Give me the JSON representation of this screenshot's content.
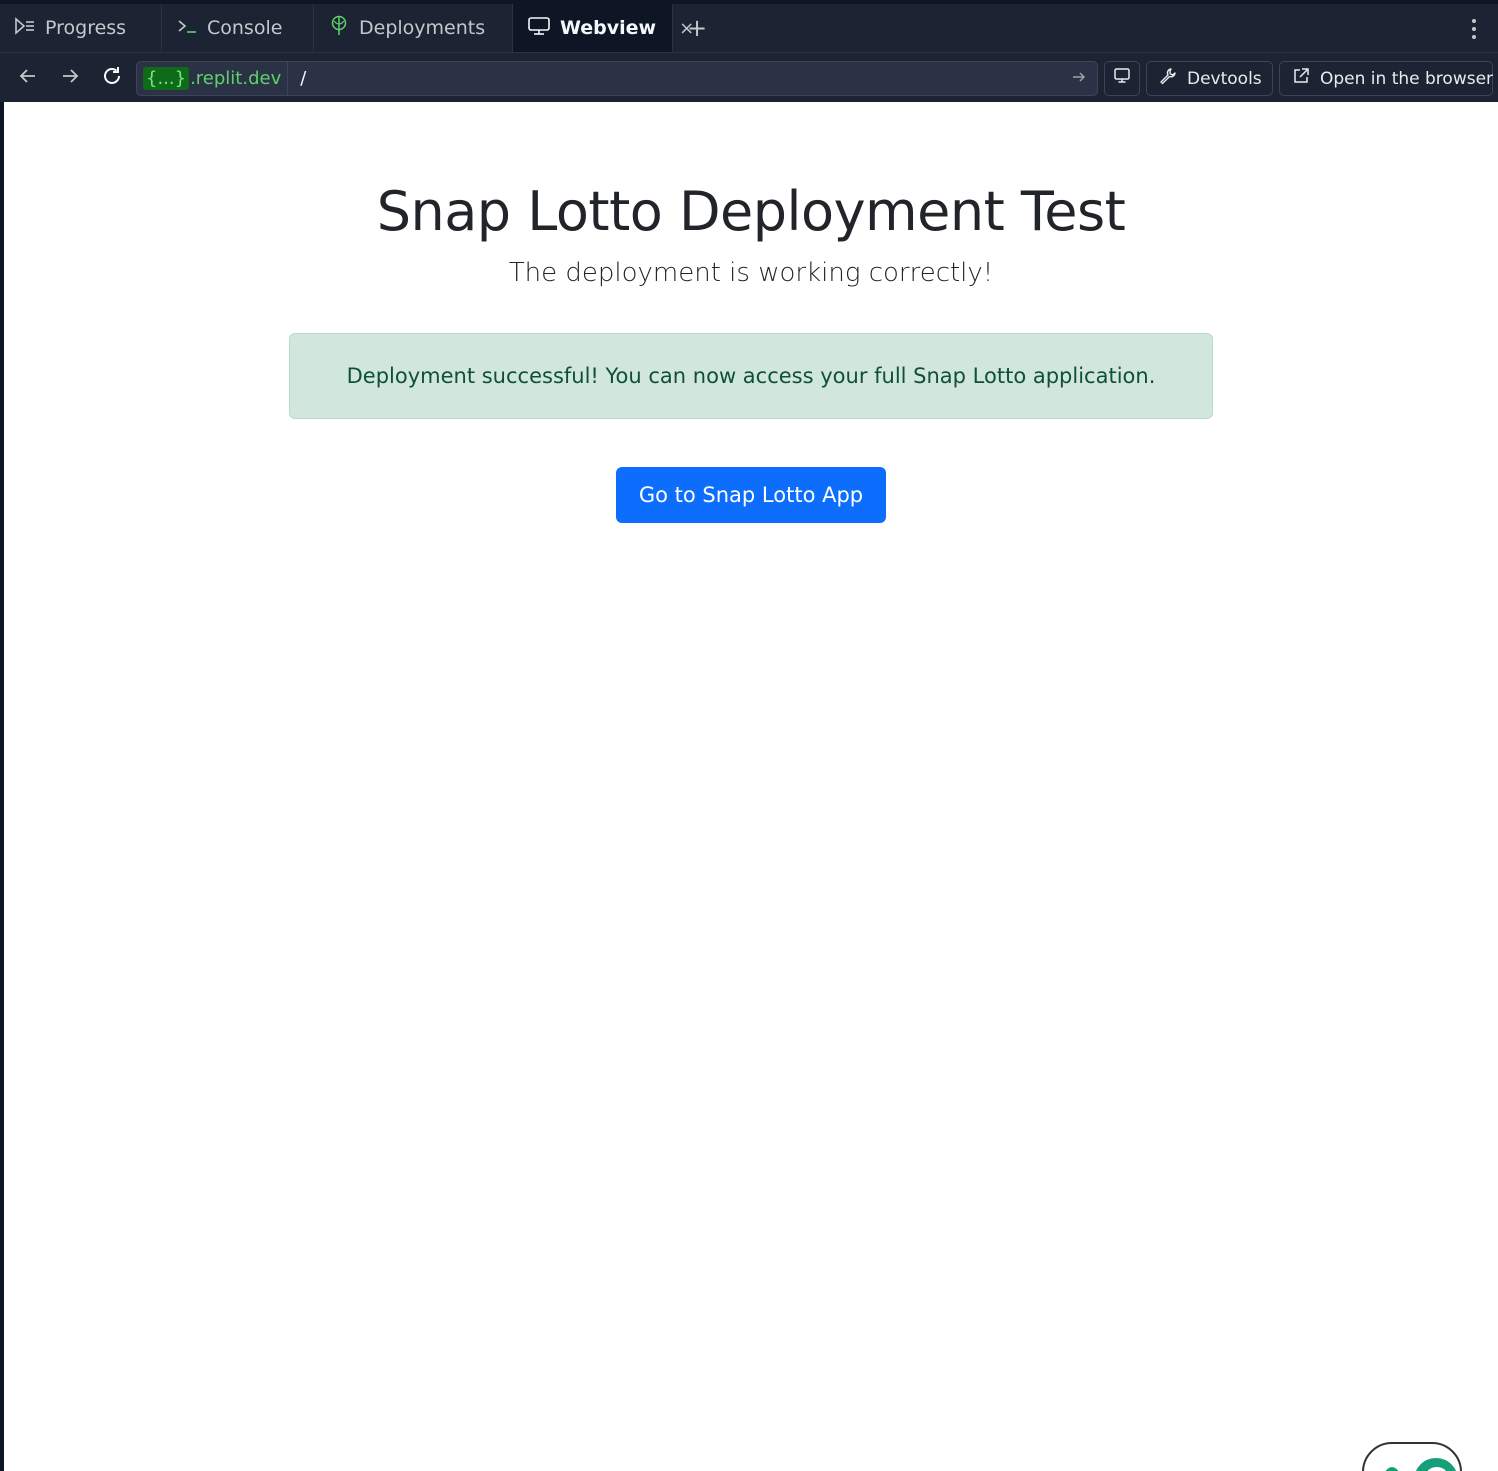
{
  "tabs": [
    {
      "label": "Progress",
      "icon": "progress-icon",
      "active": false
    },
    {
      "label": "Console",
      "icon": "console-icon",
      "active": false
    },
    {
      "label": "Deployments",
      "icon": "deployments-icon",
      "active": false
    },
    {
      "label": "Webview",
      "icon": "monitor-icon",
      "active": true
    }
  ],
  "tab_close_glyph": "×",
  "new_tab_glyph": "+",
  "url": {
    "badge": "{...}",
    "domain": ".replit.dev",
    "path": "/"
  },
  "toolbar": {
    "devtools_label": "Devtools",
    "open_browser_label": "Open in the browser"
  },
  "page": {
    "title": "Snap Lotto Deployment Test",
    "subtitle": "The deployment is working correctly!",
    "alert_text": "Deployment successful! You can now access your full Snap Lotto application.",
    "cta_label": "Go to Snap Lotto App"
  },
  "colors": {
    "primary_button": "#0d6efd",
    "alert_bg": "#d1e7dd",
    "alert_text": "#0f5132",
    "chrome_bg": "#1c2333",
    "url_green": "#5ed16b"
  }
}
